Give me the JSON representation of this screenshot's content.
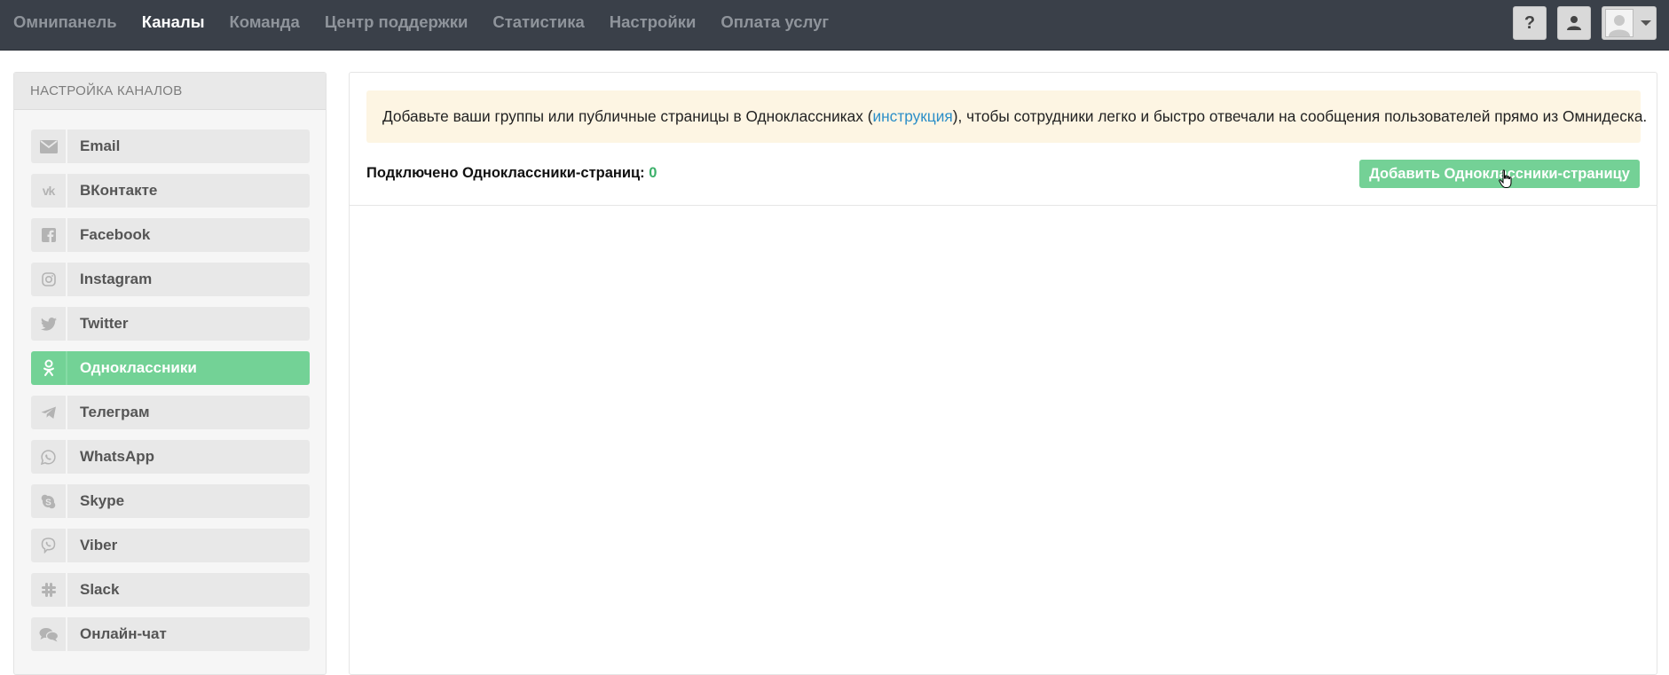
{
  "nav": {
    "items": [
      {
        "label": "Омнипанель",
        "active": false
      },
      {
        "label": "Каналы",
        "active": true
      },
      {
        "label": "Команда",
        "active": false
      },
      {
        "label": "Центр поддержки",
        "active": false
      },
      {
        "label": "Статистика",
        "active": false
      },
      {
        "label": "Настройки",
        "active": false
      },
      {
        "label": "Оплата услуг",
        "active": false
      }
    ],
    "help_label": "?",
    "icons": [
      "user-icon",
      "avatar-icon",
      "caret-down-icon"
    ]
  },
  "sidebar": {
    "title": "НАСТРОЙКА КАНАЛОВ",
    "channels": [
      {
        "label": "Email",
        "icon": "envelope-icon"
      },
      {
        "label": "ВКонтакте",
        "icon": "vk-icon"
      },
      {
        "label": "Facebook",
        "icon": "facebook-icon"
      },
      {
        "label": "Instagram",
        "icon": "instagram-icon"
      },
      {
        "label": "Twitter",
        "icon": "twitter-icon"
      },
      {
        "label": "Одноклассники",
        "icon": "odnoklassniki-icon",
        "active": true
      },
      {
        "label": "Телеграм",
        "icon": "telegram-icon"
      },
      {
        "label": "WhatsApp",
        "icon": "whatsapp-icon"
      },
      {
        "label": "Skype",
        "icon": "skype-icon"
      },
      {
        "label": "Viber",
        "icon": "viber-icon"
      },
      {
        "label": "Slack",
        "icon": "slack-icon"
      },
      {
        "label": "Онлайн-чат",
        "icon": "chat-icon"
      }
    ]
  },
  "main": {
    "notice": {
      "before": "Добавьте ваши группы или публичные страницы в Одноклассниках (",
      "link": "инструкция",
      "after": "), чтобы сотрудники легко и быстро отвечали на сообщения пользователей прямо из Омнидеска."
    },
    "connected_label": "Подключено Одноклассники-страниц:",
    "connected_count": "0",
    "add_button": "Добавить Одноклассники-страницу"
  },
  "colors": {
    "topbar": "#3a4049",
    "accent_green": "#73d296",
    "count_green": "#3cb06a",
    "link_blue": "#2d8fc8",
    "notice_bg": "#fdf5e3"
  }
}
